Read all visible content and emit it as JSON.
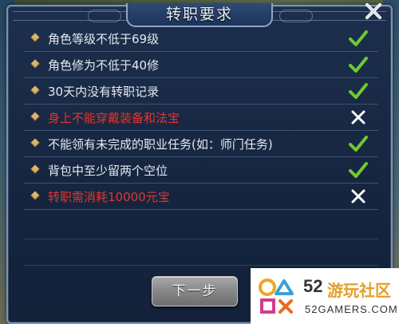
{
  "dialog": {
    "title": "转职要求",
    "close_icon": "close-x-icon",
    "next_button_label": "下一步"
  },
  "requirements": [
    {
      "text": "角色等级不低于69级",
      "met": true,
      "status_icon": "check-icon"
    },
    {
      "text": "角色修为不低于40修",
      "met": true,
      "status_icon": "check-icon"
    },
    {
      "text": "30天内没有转职记录",
      "met": true,
      "status_icon": "check-icon"
    },
    {
      "text": "身上不能穿戴装备和法宝",
      "met": false,
      "status_icon": "cross-icon"
    },
    {
      "text": "不能领有未完成的职业任务(如：师门任务)",
      "met": true,
      "status_icon": "check-icon"
    },
    {
      "text": "背包中至少留两个空位",
      "met": true,
      "status_icon": "check-icon"
    },
    {
      "text": "转职需消耗10000元宝",
      "met": false,
      "status_icon": "cross-icon"
    }
  ],
  "colors": {
    "met_text": "#e4e9f0",
    "unmet_text": "#e2352e",
    "check": "#6ecb2f",
    "cross": "#ffffff",
    "bullet": "#d9b46a"
  },
  "watermark": {
    "number": "52",
    "name": "游玩社区",
    "domain": "52GAMERS.COM"
  }
}
